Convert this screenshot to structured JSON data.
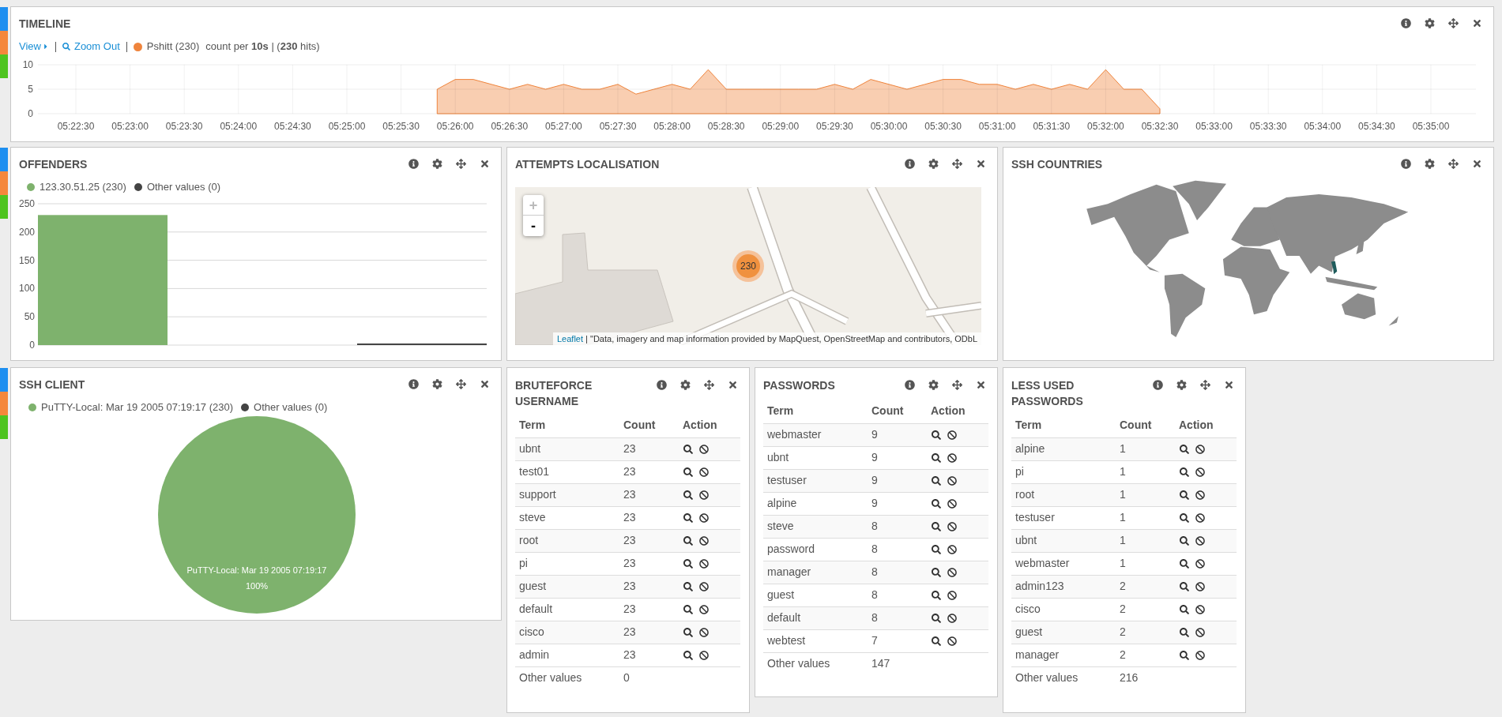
{
  "rows": [
    {
      "side_tabs": [
        {
          "color": "#1e8ff0"
        },
        {
          "color": "#f5873b"
        },
        {
          "color": "#4ec41f"
        }
      ],
      "panels": [
        {
          "kind": "timeline",
          "title": "TIMELINE",
          "view_link": "View",
          "zoom_link": "Zoom Out",
          "info": "count per **10s** | (**230** hits)",
          "legend": [
            {
              "label": "Pshitt (230)"
            }
          ],
          "chart_data": {
            "type": "area",
            "grid": true,
            "categories": [
              "05:22:30",
              null,
              null,
              "05:23:00",
              null,
              null,
              "05:23:30",
              null,
              null,
              "05:24:00",
              null,
              null,
              "05:24:30",
              null,
              null,
              "05:25:00",
              null,
              null,
              "05:25:30",
              null,
              null,
              "05:26:00",
              null,
              null,
              "05:26:30",
              null,
              null,
              "05:27:00",
              null,
              null,
              "05:27:30",
              null,
              null,
              "05:28:00",
              null,
              null,
              "05:28:30",
              null,
              null,
              "05:29:00",
              null,
              null,
              "05:29:30",
              null,
              null,
              "05:30:00",
              null,
              null,
              "05:30:30",
              null,
              null,
              "05:31:00",
              null,
              null,
              "05:31:30",
              null,
              null,
              "05:32:00",
              null,
              null,
              "05:32:30",
              null,
              null,
              "05:33:00",
              null,
              null,
              "05:33:30",
              null,
              null,
              "05:34:00",
              null,
              null,
              "05:34:30",
              null,
              null,
              "05:35:00"
            ],
            "series": [
              {
                "color": "#ef843c",
                "values": [
                  null,
                  null,
                  null,
                  null,
                  null,
                  null,
                  null,
                  null,
                  null,
                  null,
                  null,
                  null,
                  null,
                  null,
                  null,
                  null,
                  null,
                  null,
                  null,
                  null,
                  5,
                  7,
                  7,
                  6,
                  5,
                  6,
                  5,
                  6,
                  5,
                  5,
                  6,
                  4,
                  5,
                  6,
                  5,
                  9,
                  5,
                  5,
                  5,
                  5,
                  5,
                  5,
                  6,
                  5,
                  7,
                  6,
                  5,
                  6,
                  7,
                  7,
                  6,
                  6,
                  5,
                  6,
                  5,
                  6,
                  5,
                  9,
                  5,
                  5,
                  1,
                  null,
                  null,
                  null,
                  null,
                  null,
                  null,
                  null,
                  null,
                  null,
                  null,
                  null,
                  null,
                  null,
                  null,
                  null
                ]
              }
            ],
            "ylim": [
              0,
              10
            ],
            "yticks": [
              0,
              5,
              10
            ]
          }
        }
      ]
    },
    {
      "side_tabs": [
        {
          "color": "#1e8ff0"
        },
        {
          "color": "#f5873b"
        },
        {
          "color": "#4ec41f"
        }
      ],
      "panels": [
        {
          "kind": "bar",
          "title": "OFFENDERS",
          "legend": [
            {
              "label": "123.30.51.25 (230)"
            },
            {
              "label": "Other values (0)"
            }
          ],
          "chart_data": {
            "type": "bar",
            "grid": true,
            "series": [
              {
                "color": "#7eb26d",
                "values": [
                  230
                ]
              },
              {
                "color": "#444444",
                "values": [
                  0
                ]
              }
            ],
            "ylim": [
              0,
              250
            ],
            "yticks": [
              0,
              50,
              100,
              150,
              200,
              250
            ]
          }
        },
        {
          "kind": "map",
          "title": "ATTEMPTS LOCALISATION",
          "zoom_in": "+",
          "zoom_out": "-",
          "cluster": "230",
          "attribution_link": "Leaflet",
          "attribution": "| \"Data, imagery and map information provided by MapQuest, OpenStreetMap and contributors, ODbL"
        },
        {
          "kind": "world_map",
          "title": "SSH COUNTRIES"
        }
      ]
    },
    {
      "side_tabs": [
        {
          "color": "#1e8ff0"
        },
        {
          "color": "#f5873b"
        },
        {
          "color": "#4ec41f"
        }
      ],
      "panels": [
        {
          "kind": "pie",
          "title": "SSH CLIENT",
          "legend": [
            {
              "label": "PuTTY-Local: Mar 19 2005 07:19:17 (230)",
              "color": "#7eb26d"
            },
            {
              "label": "Other values (0)",
              "color": "#444444"
            }
          ],
          "slice_percent": "100%",
          "chart_data": {
            "type": "pie",
            "categories": [
              "PuTTY-Local: Mar 19 2005 07:19:17"
            ],
            "series": [
              {
                "color": "#7eb26d",
                "values": [
                  100
                ]
              }
            ]
          }
        },
        {
          "kind": "table",
          "title": "BRUTEFORCE USERNAME",
          "columns": [
            "Term",
            "Count",
            "Action"
          ],
          "rows": [
            {
              "term": "ubnt",
              "count": "23"
            },
            {
              "term": "test01",
              "count": "23"
            },
            {
              "term": "support",
              "count": "23"
            },
            {
              "term": "steve",
              "count": "23"
            },
            {
              "term": "root",
              "count": "23"
            },
            {
              "term": "pi",
              "count": "23"
            },
            {
              "term": "guest",
              "count": "23"
            },
            {
              "term": "default",
              "count": "23"
            },
            {
              "term": "cisco",
              "count": "23"
            },
            {
              "term": "admin",
              "count": "23"
            }
          ],
          "other": {
            "term": "Other values",
            "count": "0"
          }
        },
        {
          "kind": "table",
          "title": "PASSWORDS",
          "columns": [
            "Term",
            "Count",
            "Action"
          ],
          "rows": [
            {
              "term": "webmaster",
              "count": "9"
            },
            {
              "term": "ubnt",
              "count": "9"
            },
            {
              "term": "testuser",
              "count": "9"
            },
            {
              "term": "alpine",
              "count": "9"
            },
            {
              "term": "steve",
              "count": "8"
            },
            {
              "term": "password",
              "count": "8"
            },
            {
              "term": "manager",
              "count": "8"
            },
            {
              "term": "guest",
              "count": "8"
            },
            {
              "term": "default",
              "count": "8"
            },
            {
              "term": "webtest",
              "count": "7"
            }
          ],
          "other": {
            "term": "Other values",
            "count": "147"
          }
        },
        {
          "kind": "table",
          "title": "LESS USED PASSWORDS",
          "columns": [
            "Term",
            "Count",
            "Action"
          ],
          "rows": [
            {
              "term": "alpine",
              "count": "1"
            },
            {
              "term": "pi",
              "count": "1"
            },
            {
              "term": "root",
              "count": "1"
            },
            {
              "term": "testuser",
              "count": "1"
            },
            {
              "term": "ubnt",
              "count": "1"
            },
            {
              "term": "webmaster",
              "count": "1"
            },
            {
              "term": "admin123",
              "count": "2"
            },
            {
              "term": "cisco",
              "count": "2"
            },
            {
              "term": "guest",
              "count": "2"
            },
            {
              "term": "manager",
              "count": "2"
            }
          ],
          "other": {
            "term": "Other values",
            "count": "216"
          }
        }
      ]
    }
  ]
}
